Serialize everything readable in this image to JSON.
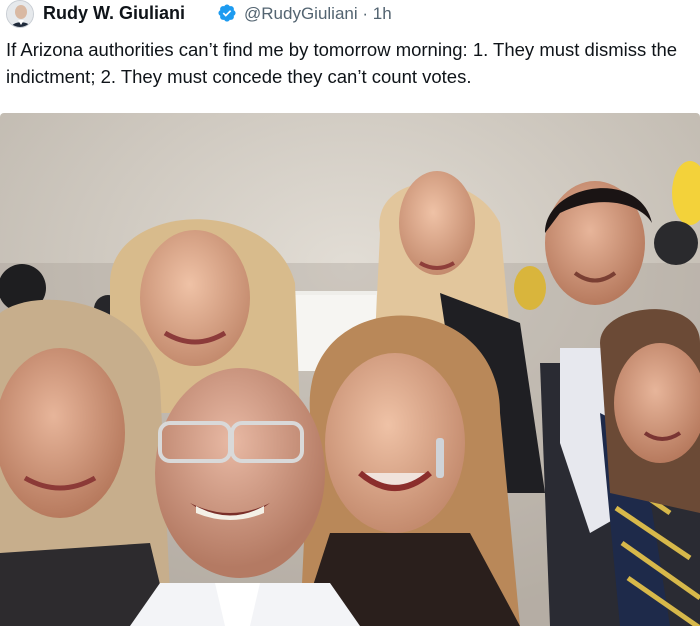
{
  "tweet": {
    "author_name": "Rudy W. Giuliani",
    "handle": "@RudyGiuliani",
    "separator": "·",
    "time": "1h",
    "text": "If Arizona authorities can’t find me by tomorrow morning: 1. They must dismiss the indictment; 2. They must concede they can’t count votes.",
    "verified_icon": "verified-badge-icon",
    "avatar_icon": "profile-avatar",
    "photo_alt": "group-selfie-photo"
  },
  "colors": {
    "verified_blue": "#1d9bf0",
    "handle_gray": "#536471",
    "text_black": "#0f1419"
  }
}
